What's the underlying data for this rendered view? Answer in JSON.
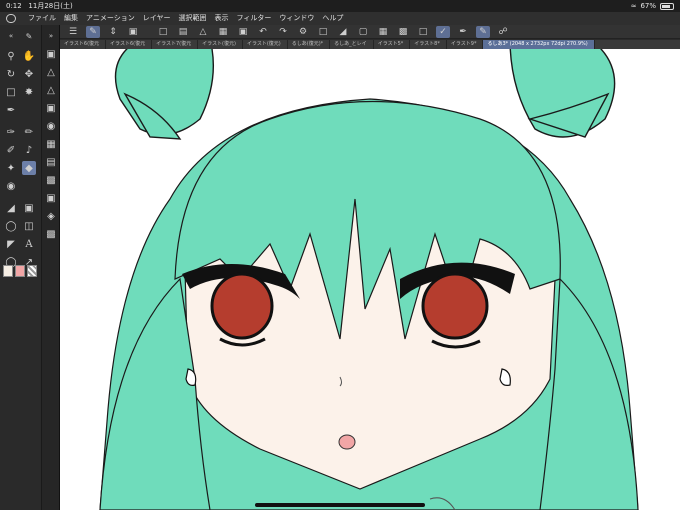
{
  "status": {
    "time": "0:12",
    "date": "11月28日(土)",
    "battery": "67%",
    "battery_level": 0.67
  },
  "menu": [
    "ファイル",
    "編集",
    "アニメーション",
    "レイヤー",
    "選択範囲",
    "表示",
    "フィルター",
    "ウィンドウ",
    "ヘルプ"
  ],
  "tabs": [
    {
      "label": "イラスト6(復元"
    },
    {
      "label": "イラスト6(復元"
    },
    {
      "label": "イラスト7(復元"
    },
    {
      "label": "イラスト(復元)"
    },
    {
      "label": "イラスト(復元)"
    },
    {
      "label": "るしあ(復元)*"
    },
    {
      "label": "るしあ_とレイ"
    },
    {
      "label": "イラスト5*"
    },
    {
      "label": "イラスト8*"
    },
    {
      "label": "イラスト9*"
    },
    {
      "label": "るしあ3* (2048 x 2732px 72dpi 270.9%)"
    }
  ],
  "colors": {
    "hair": "#6fdcbb",
    "skin": "#fcf2ea",
    "eye": "#b53d2e",
    "mouth": "#f1a6a6",
    "accent": "#5b6f98"
  }
}
